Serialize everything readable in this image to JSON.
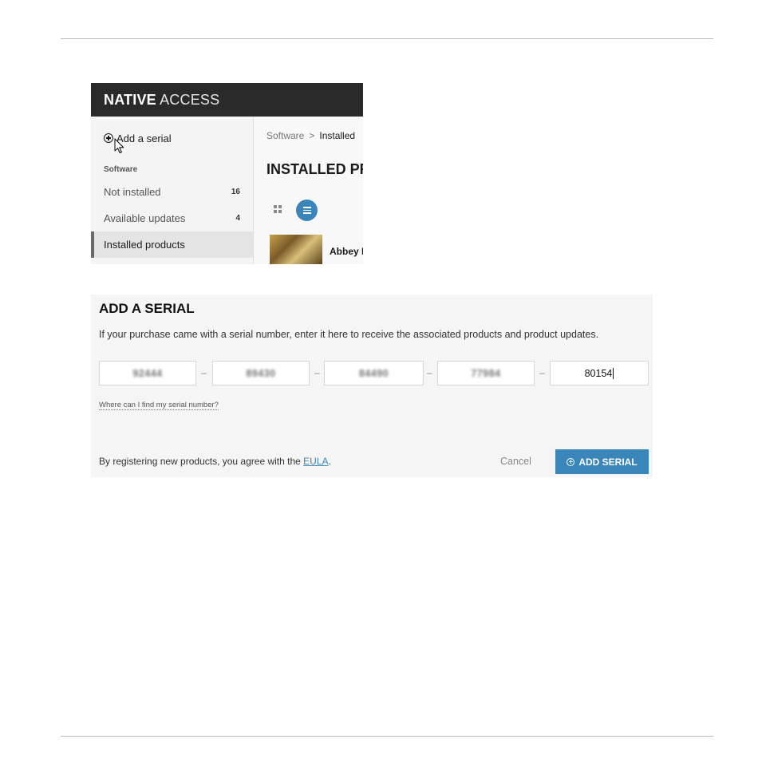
{
  "app": {
    "title_bold": "NATIVE",
    "title_light": "ACCESS"
  },
  "sidebar": {
    "add_serial_label": "Add a serial",
    "section_label": "Software",
    "items": [
      {
        "label": "Not installed",
        "count": "16"
      },
      {
        "label": "Available updates",
        "count": "4"
      },
      {
        "label": "Installed products",
        "selected": true
      }
    ]
  },
  "main": {
    "breadcrumb": {
      "root": "Software",
      "separator": ">",
      "current": "Installed"
    },
    "heading": "INSTALLED PR",
    "view_modes": {
      "grid_icon": "grid-icon",
      "list_icon": "list-icon",
      "active": "list"
    },
    "product_name": "Abbey R"
  },
  "serial_dialog": {
    "heading": "ADD A SERIAL",
    "description": "If your purchase came with a serial number, enter it here to receive the associated products and product updates.",
    "fields": [
      "92444",
      "89430",
      "84490",
      "77984",
      "80154"
    ],
    "separator": "–",
    "help_link": "Where can I find my serial number?",
    "agreement_prefix": "By registering new products, you agree with the",
    "eula_label": "EULA",
    "agreement_suffix": ".",
    "cancel_label": "Cancel",
    "add_button_label": "ADD SERIAL"
  },
  "colors": {
    "accent": "#3a86ba",
    "header_bg": "#2a2a2a",
    "panel_bg": "#f5f5f5"
  }
}
